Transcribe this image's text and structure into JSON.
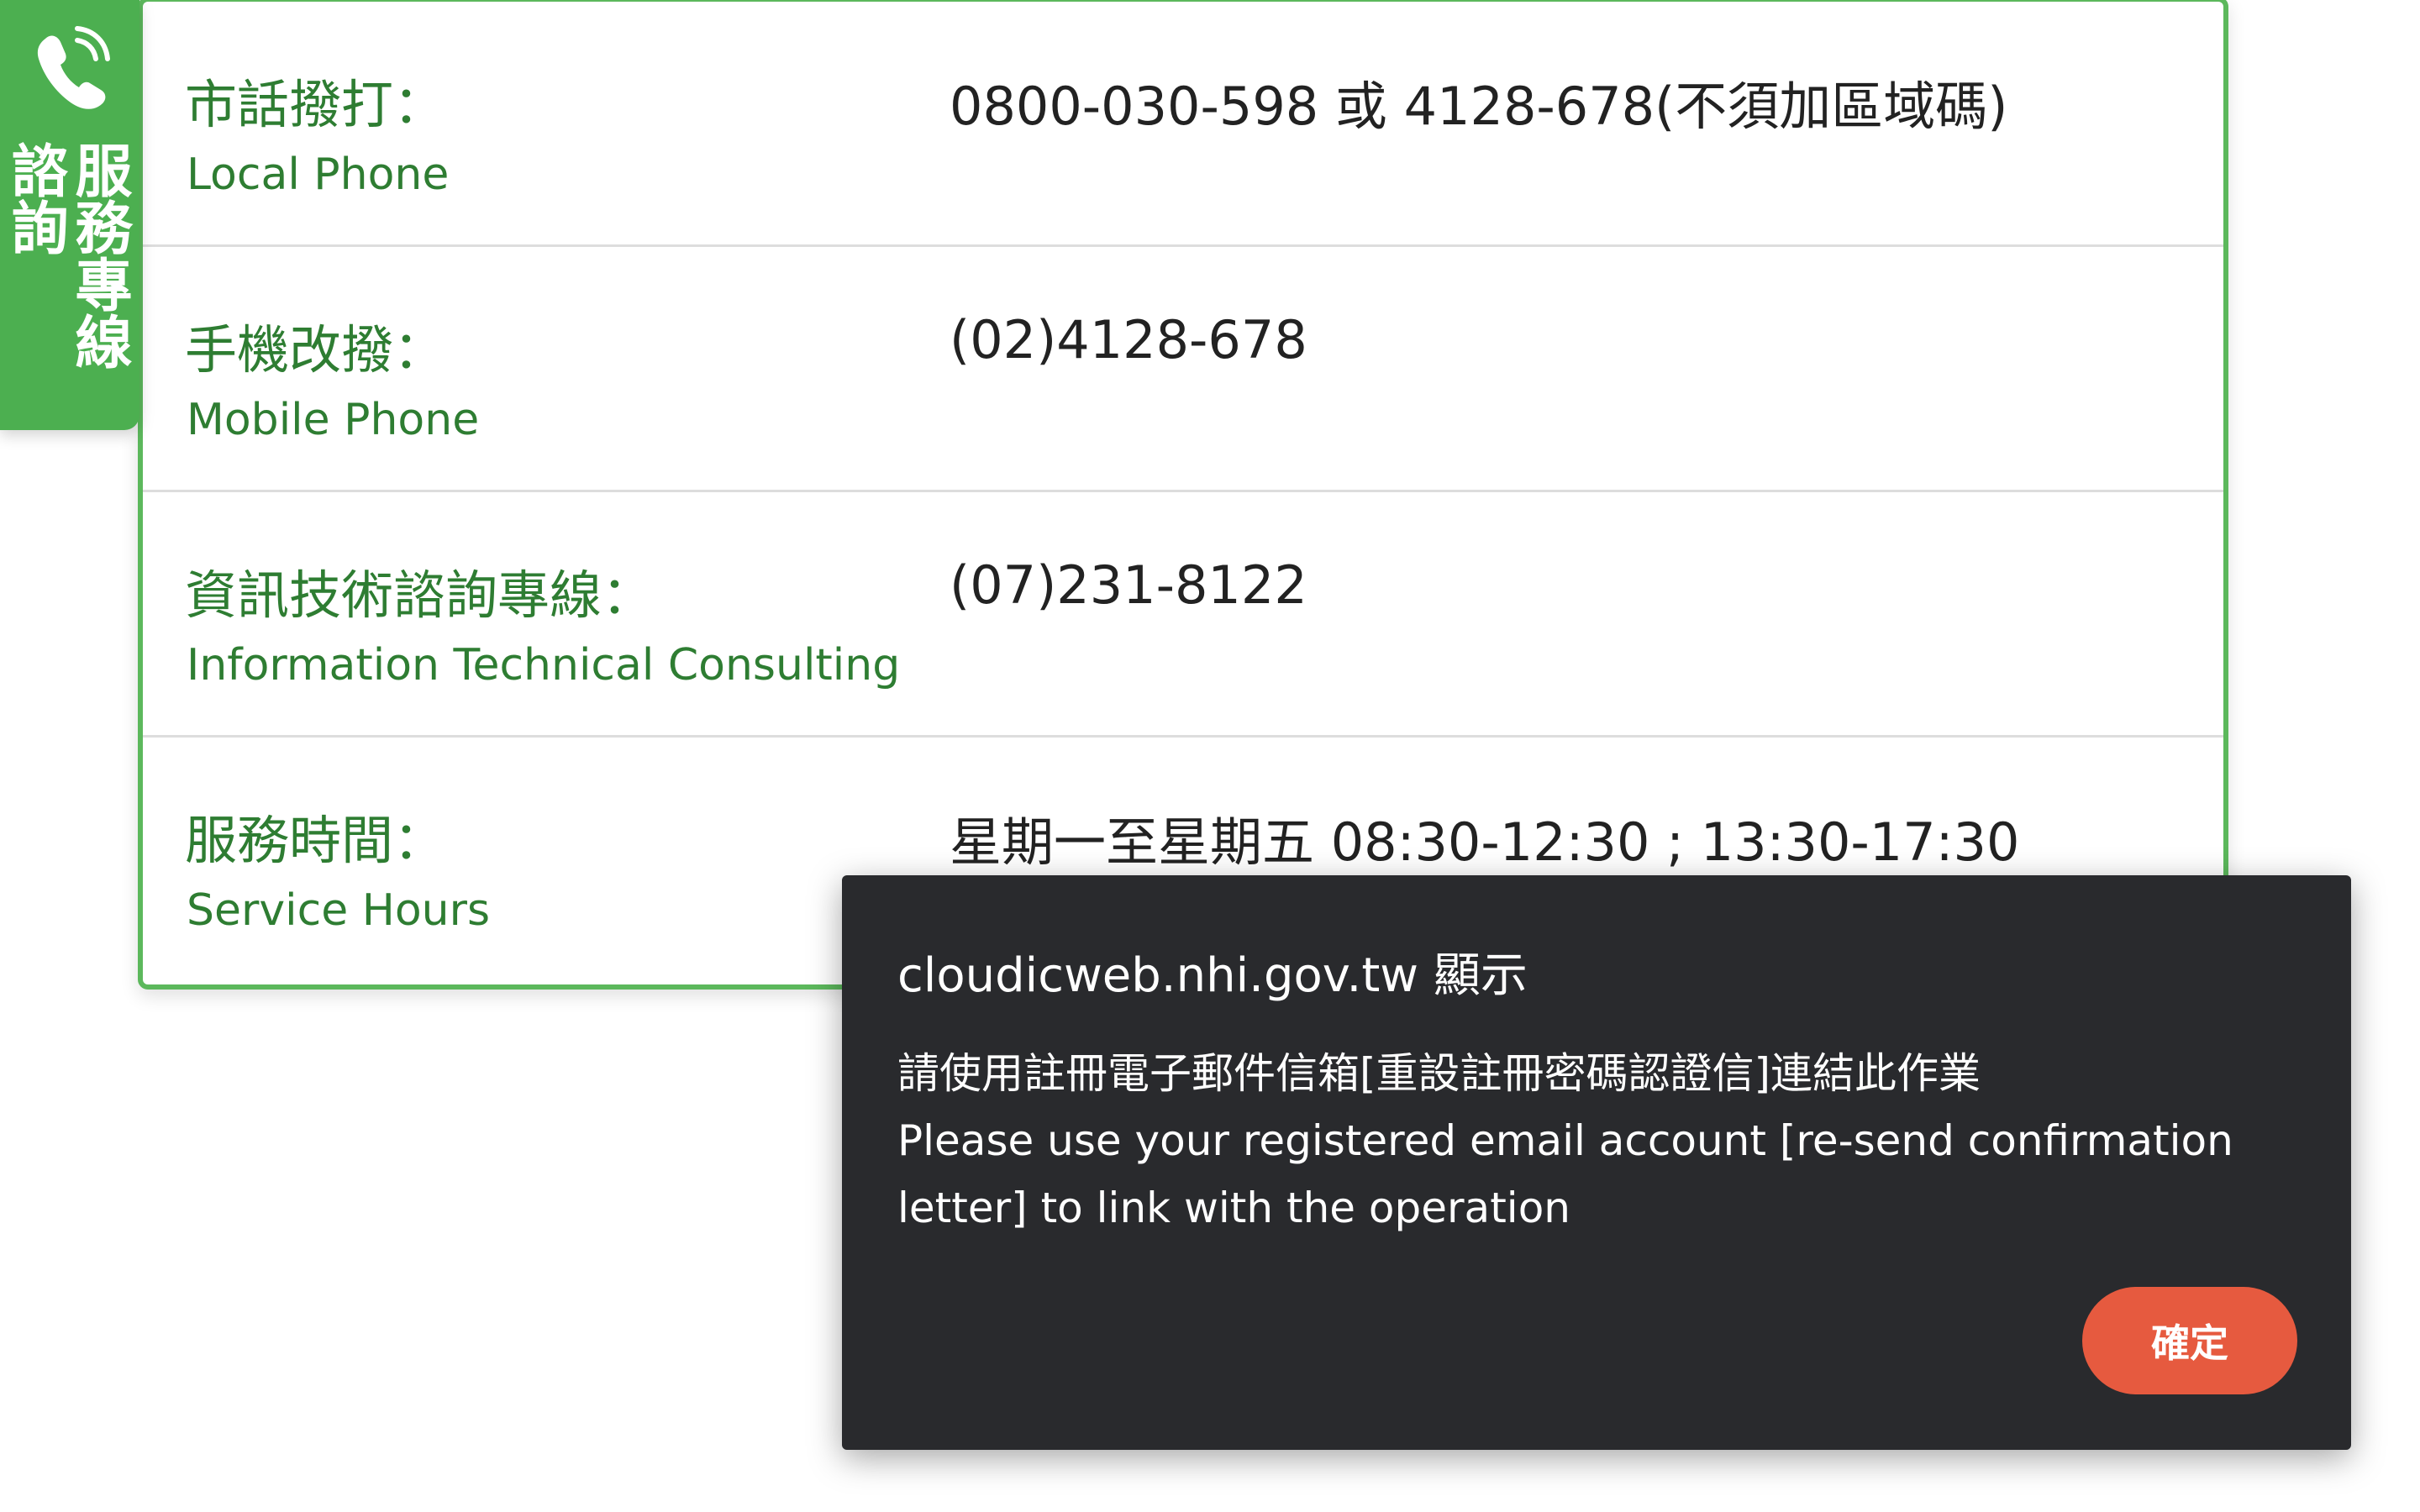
{
  "side_tab": {
    "icon": "phone-icon",
    "text": "服務專線諮詢",
    "color": "#4caf50"
  },
  "panel": {
    "accent_color": "#5cb85c",
    "label_color": "#2e7d32",
    "rows": [
      {
        "label_zh": "市話撥打：",
        "label_en": "Local Phone",
        "value": "0800-030-598 或 4128-678(不須加區域碼)"
      },
      {
        "label_zh": "手機改撥：",
        "label_en": "Mobile Phone",
        "value": "(02)4128-678"
      },
      {
        "label_zh": "資訊技術諮詢專線：",
        "label_en": "Information Technical Consulting",
        "value": "(07)231-8122"
      },
      {
        "label_zh": "服務時間：",
        "label_en": "Service Hours",
        "value": "星期一至星期五 08:30-12:30 ; 13:30-17:30"
      }
    ]
  },
  "dialog": {
    "title": "cloudicweb.nhi.gov.tw 顯示",
    "message_lines": [
      "請使用註冊電子郵件信箱[重設註冊密碼認證信]連結此作業",
      "Please use your registered email account [re-send confirmation",
      "letter] to link with the operation"
    ],
    "ok_label": "確定",
    "background_color": "#292a2d",
    "button_color": "#e65a3f"
  }
}
